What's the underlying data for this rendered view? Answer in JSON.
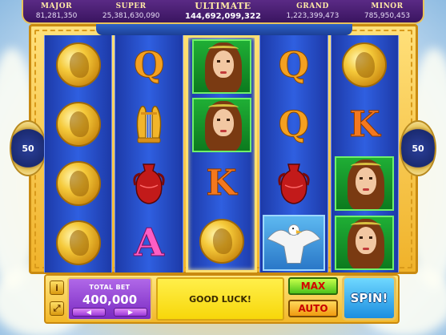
{
  "jackpots": [
    {
      "label": "MAJOR",
      "value": "81,281,350"
    },
    {
      "label": "SUPER",
      "value": "25,381,630,090"
    },
    {
      "label": "ULTIMATE",
      "value": "144,692,099,322"
    },
    {
      "label": "GRAND",
      "value": "1,223,399,473"
    },
    {
      "label": "MINOR",
      "value": "785,950,453"
    }
  ],
  "lines_left": "50",
  "lines_right": "50",
  "reels": [
    [
      "coin",
      "coin",
      "coin",
      "coin"
    ],
    [
      "letter-q",
      "lyre",
      "vase",
      "letter-a"
    ],
    [
      "goddess",
      "goddess",
      "letter-k",
      "coin"
    ],
    [
      "letter-q",
      "letter-q",
      "vase",
      "eagle"
    ],
    [
      "coin",
      "letter-k",
      "goddess",
      "goddess"
    ]
  ],
  "highlighted_reel": 2,
  "symbols": {
    "letter-q": "Q",
    "letter-k": "K",
    "letter-a": "A"
  },
  "total_bet": {
    "label": "TOTAL BET",
    "value": "400,000"
  },
  "message": "GOOD LUCK!",
  "buttons": {
    "max": "MAX",
    "auto": "AUTO",
    "spin": "SPIN!",
    "info": "i"
  },
  "colors": {
    "frame_gold": "#f0b22a",
    "reel_blue": "#2f5fe0",
    "spin_blue": "#1c8ee0",
    "bet_purple": "#7a2ac2"
  }
}
